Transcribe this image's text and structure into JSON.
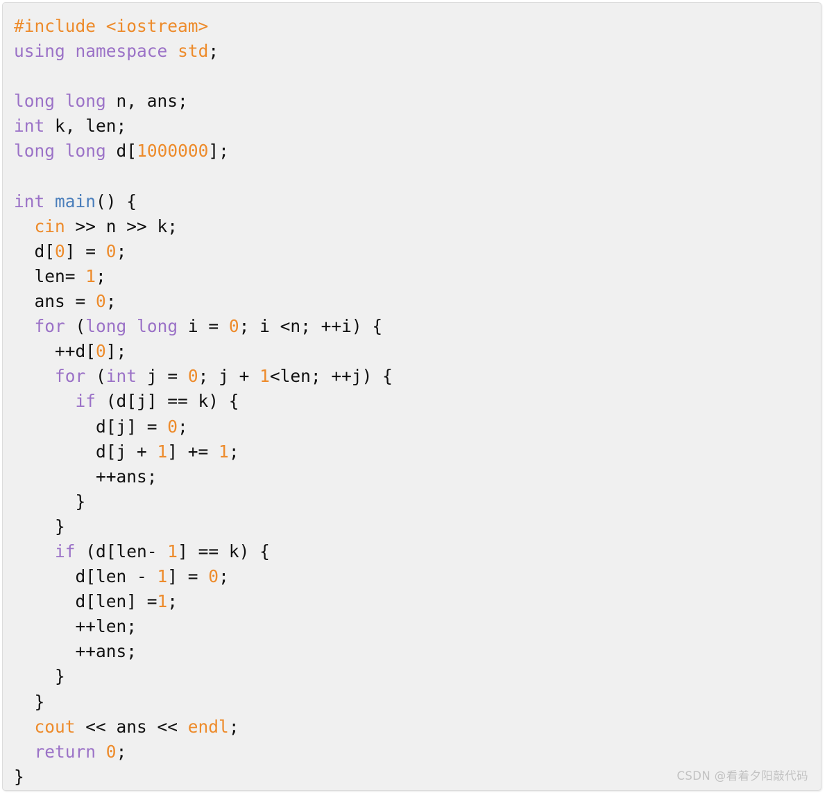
{
  "card": {
    "background_color": "#f0f0f0",
    "border_color": "#dcdcdc",
    "language": "cpp"
  },
  "theme": {
    "preprocessor_color": "#ed8b2b",
    "keyword_color": "#9b72c7",
    "library_color": "#ed8b2b",
    "number_color": "#ed8b2b",
    "function_color": "#4a7ebb",
    "identifier_color": "#111111",
    "watermark_color": "#c2c2c2"
  },
  "watermark": {
    "text": "CSDN @看着夕阳敲代码"
  },
  "code": {
    "lines": [
      {
        "n": 1,
        "tokens": [
          {
            "t": "#include",
            "c": "pp"
          },
          {
            "t": " ",
            "c": "id"
          },
          {
            "t": "<iostream>",
            "c": "pp"
          }
        ]
      },
      {
        "n": 2,
        "tokens": [
          {
            "t": "using",
            "c": "kw"
          },
          {
            "t": " ",
            "c": "id"
          },
          {
            "t": "namespace",
            "c": "kw"
          },
          {
            "t": " ",
            "c": "id"
          },
          {
            "t": "std",
            "c": "lib"
          },
          {
            "t": ";",
            "c": "id"
          }
        ]
      },
      {
        "n": 3,
        "tokens": []
      },
      {
        "n": 4,
        "tokens": [
          {
            "t": "long",
            "c": "kw"
          },
          {
            "t": " ",
            "c": "id"
          },
          {
            "t": "long",
            "c": "kw"
          },
          {
            "t": " n, ans;",
            "c": "id"
          }
        ]
      },
      {
        "n": 5,
        "tokens": [
          {
            "t": "int",
            "c": "kw"
          },
          {
            "t": " k, len;",
            "c": "id"
          }
        ]
      },
      {
        "n": 6,
        "tokens": [
          {
            "t": "long",
            "c": "kw"
          },
          {
            "t": " ",
            "c": "id"
          },
          {
            "t": "long",
            "c": "kw"
          },
          {
            "t": " d[",
            "c": "id"
          },
          {
            "t": "1000000",
            "c": "num"
          },
          {
            "t": "];",
            "c": "id"
          }
        ]
      },
      {
        "n": 7,
        "tokens": []
      },
      {
        "n": 8,
        "tokens": [
          {
            "t": "int",
            "c": "kw"
          },
          {
            "t": " ",
            "c": "id"
          },
          {
            "t": "main",
            "c": "fn"
          },
          {
            "t": "() {",
            "c": "id"
          }
        ]
      },
      {
        "n": 9,
        "tokens": [
          {
            "t": "  ",
            "c": "id"
          },
          {
            "t": "cin",
            "c": "lib"
          },
          {
            "t": " >> n >> k;",
            "c": "id"
          }
        ]
      },
      {
        "n": 10,
        "tokens": [
          {
            "t": "  d[",
            "c": "id"
          },
          {
            "t": "0",
            "c": "num"
          },
          {
            "t": "] = ",
            "c": "id"
          },
          {
            "t": "0",
            "c": "num"
          },
          {
            "t": ";",
            "c": "id"
          }
        ]
      },
      {
        "n": 11,
        "tokens": [
          {
            "t": "  len= ",
            "c": "id"
          },
          {
            "t": "1",
            "c": "num"
          },
          {
            "t": ";",
            "c": "id"
          }
        ]
      },
      {
        "n": 12,
        "tokens": [
          {
            "t": "  ans = ",
            "c": "id"
          },
          {
            "t": "0",
            "c": "num"
          },
          {
            "t": ";",
            "c": "id"
          }
        ]
      },
      {
        "n": 13,
        "tokens": [
          {
            "t": "  ",
            "c": "id"
          },
          {
            "t": "for",
            "c": "kw"
          },
          {
            "t": " (",
            "c": "id"
          },
          {
            "t": "long",
            "c": "kw"
          },
          {
            "t": " ",
            "c": "id"
          },
          {
            "t": "long",
            "c": "kw"
          },
          {
            "t": " i = ",
            "c": "id"
          },
          {
            "t": "0",
            "c": "num"
          },
          {
            "t": "; i <n; ++i) {",
            "c": "id"
          }
        ]
      },
      {
        "n": 14,
        "tokens": [
          {
            "t": "    ++d[",
            "c": "id"
          },
          {
            "t": "0",
            "c": "num"
          },
          {
            "t": "];",
            "c": "id"
          }
        ]
      },
      {
        "n": 15,
        "tokens": [
          {
            "t": "    ",
            "c": "id"
          },
          {
            "t": "for",
            "c": "kw"
          },
          {
            "t": " (",
            "c": "id"
          },
          {
            "t": "int",
            "c": "kw"
          },
          {
            "t": " j = ",
            "c": "id"
          },
          {
            "t": "0",
            "c": "num"
          },
          {
            "t": "; j + ",
            "c": "id"
          },
          {
            "t": "1",
            "c": "num"
          },
          {
            "t": "<len; ++j) {",
            "c": "id"
          }
        ]
      },
      {
        "n": 16,
        "tokens": [
          {
            "t": "      ",
            "c": "id"
          },
          {
            "t": "if",
            "c": "kw"
          },
          {
            "t": " (d[j] == k) {",
            "c": "id"
          }
        ]
      },
      {
        "n": 17,
        "tokens": [
          {
            "t": "        d[j] = ",
            "c": "id"
          },
          {
            "t": "0",
            "c": "num"
          },
          {
            "t": ";",
            "c": "id"
          }
        ]
      },
      {
        "n": 18,
        "tokens": [
          {
            "t": "        d[j + ",
            "c": "id"
          },
          {
            "t": "1",
            "c": "num"
          },
          {
            "t": "] += ",
            "c": "id"
          },
          {
            "t": "1",
            "c": "num"
          },
          {
            "t": ";",
            "c": "id"
          }
        ]
      },
      {
        "n": 19,
        "tokens": [
          {
            "t": "        ++ans;",
            "c": "id"
          }
        ]
      },
      {
        "n": 20,
        "tokens": [
          {
            "t": "      }",
            "c": "id"
          }
        ]
      },
      {
        "n": 21,
        "tokens": [
          {
            "t": "    }",
            "c": "id"
          }
        ]
      },
      {
        "n": 22,
        "tokens": [
          {
            "t": "    ",
            "c": "id"
          },
          {
            "t": "if",
            "c": "kw"
          },
          {
            "t": " (d[len- ",
            "c": "id"
          },
          {
            "t": "1",
            "c": "num"
          },
          {
            "t": "] == k) {",
            "c": "id"
          }
        ]
      },
      {
        "n": 23,
        "tokens": [
          {
            "t": "      d[len - ",
            "c": "id"
          },
          {
            "t": "1",
            "c": "num"
          },
          {
            "t": "] = ",
            "c": "id"
          },
          {
            "t": "0",
            "c": "num"
          },
          {
            "t": ";",
            "c": "id"
          }
        ]
      },
      {
        "n": 24,
        "tokens": [
          {
            "t": "      d[len] =",
            "c": "id"
          },
          {
            "t": "1",
            "c": "num"
          },
          {
            "t": ";",
            "c": "id"
          }
        ]
      },
      {
        "n": 25,
        "tokens": [
          {
            "t": "      ++len;",
            "c": "id"
          }
        ]
      },
      {
        "n": 26,
        "tokens": [
          {
            "t": "      ++ans;",
            "c": "id"
          }
        ]
      },
      {
        "n": 27,
        "tokens": [
          {
            "t": "    }",
            "c": "id"
          }
        ]
      },
      {
        "n": 28,
        "tokens": [
          {
            "t": "  }",
            "c": "id"
          }
        ]
      },
      {
        "n": 29,
        "tokens": [
          {
            "t": "  ",
            "c": "id"
          },
          {
            "t": "cout",
            "c": "lib"
          },
          {
            "t": " << ans << ",
            "c": "id"
          },
          {
            "t": "endl",
            "c": "lib"
          },
          {
            "t": ";",
            "c": "id"
          }
        ]
      },
      {
        "n": 30,
        "tokens": [
          {
            "t": "  ",
            "c": "id"
          },
          {
            "t": "return",
            "c": "kw"
          },
          {
            "t": " ",
            "c": "id"
          },
          {
            "t": "0",
            "c": "num"
          },
          {
            "t": ";",
            "c": "id"
          }
        ]
      },
      {
        "n": 31,
        "tokens": [
          {
            "t": "}",
            "c": "id"
          }
        ]
      }
    ]
  }
}
